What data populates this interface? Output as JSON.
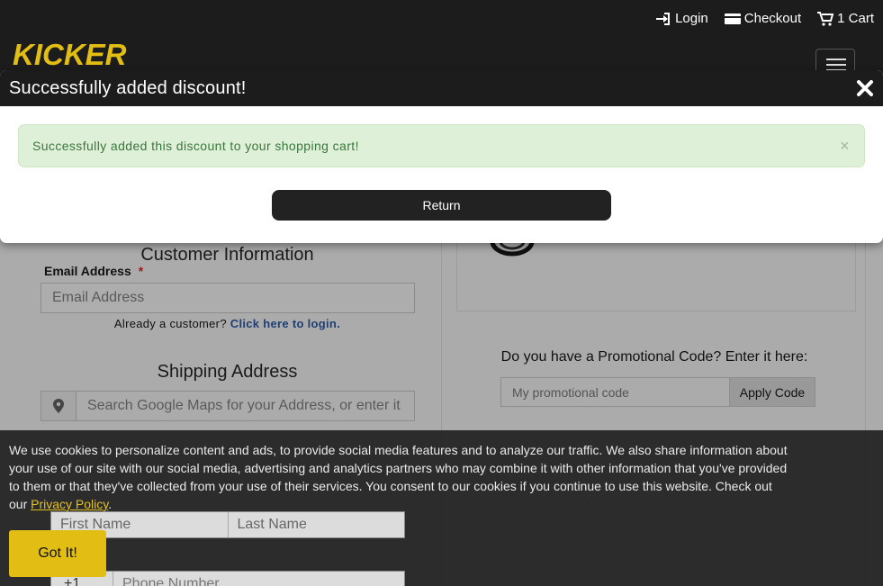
{
  "header": {
    "login_label": "Login",
    "checkout_label": "Checkout",
    "cart_label": "1 Cart",
    "logo_text": "KICKER"
  },
  "checkout": {
    "customer_info_title": "Customer Information",
    "email_label": "Email Address",
    "required_marker": "*",
    "email_placeholder": "Email Address",
    "already_customer_text": "Already a customer?",
    "login_link_text": "Click here to login.",
    "shipping_title": "Shipping Address",
    "maps_placeholder": "Search Google Maps for your Address, or enter it",
    "first_name_placeholder": "First Name",
    "last_name_placeholder": "Last Name",
    "phone_country_code": "+1",
    "phone_placeholder": "Phone Number"
  },
  "promo": {
    "prompt": "Do you have a Promotional Code? Enter it here:",
    "placeholder": "My promotional code",
    "apply_label": "Apply Code"
  },
  "modal": {
    "title": "Successfully added discount!",
    "alert_message": "Successfully added this discount to your shopping cart!",
    "alert_close": "×",
    "return_label": "Return"
  },
  "cookie": {
    "text": "We use cookies to personalize content and ads, to provide social media features and to analyze our traffic. We also share information about your use of our site with our social media, advertising and analytics partners who may combine it with other information that you've provided to them or that they've collected from your use of their services. You consent to our cookies if you continue to use this website. Check out our",
    "policy_link": "Privacy Policy",
    "after_link": ".",
    "accept_label": "Got It!"
  },
  "colors": {
    "brand_yellow": "#e2be14",
    "alert_green_bg": "#def0d8",
    "alert_green_text": "#3c763d",
    "dark": "#1c1c1c"
  }
}
